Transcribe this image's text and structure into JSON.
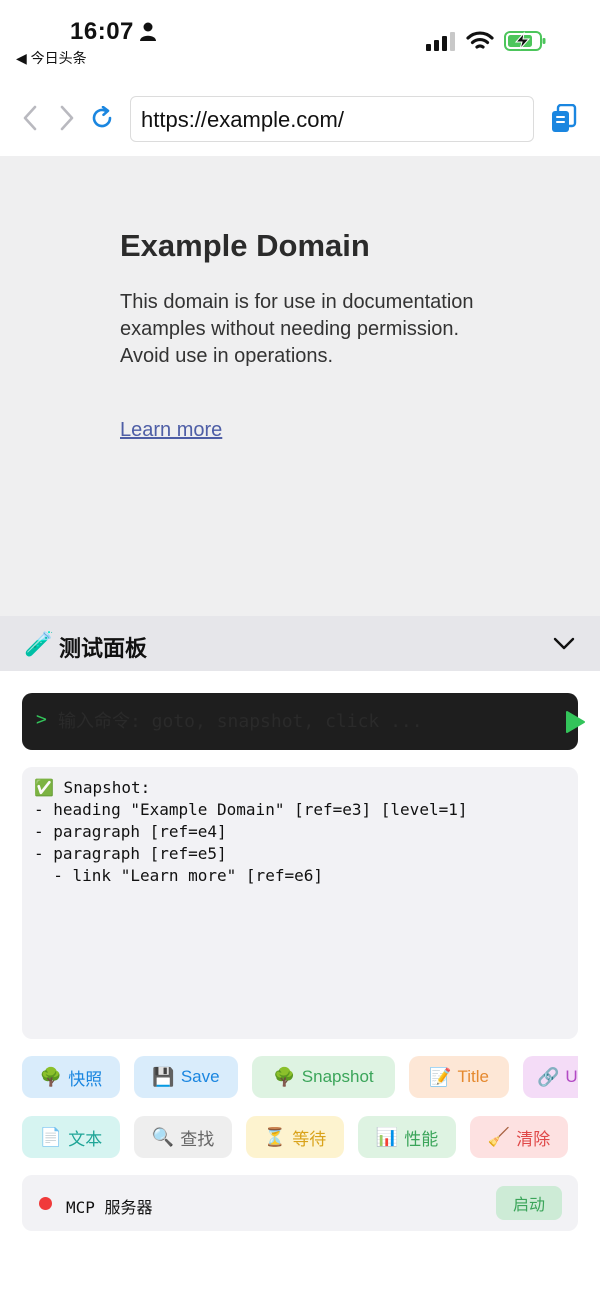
{
  "status_bar": {
    "time": "16:07",
    "back_app": "◀ 今日头条"
  },
  "browser": {
    "url": "https://example.com/"
  },
  "webpage": {
    "heading": "Example Domain",
    "paragraph": "This domain is for use in documentation examples without needing permission. Avoid use in operations.",
    "link": "Learn more"
  },
  "panel": {
    "emoji": "🧪",
    "title": "测试面板"
  },
  "command": {
    "prompt": ">",
    "placeholder": "输入命令: goto, snapshot, click ..."
  },
  "output": {
    "lines": [
      "✅ Snapshot:",
      "- heading \"Example Domain\" [ref=e3] [level=1]",
      "- paragraph [ref=e4]",
      "- paragraph [ref=e5]",
      "  - link \"Learn more\" [ref=e6]"
    ]
  },
  "actions_row1": [
    {
      "emoji": "🌳",
      "label": "快照"
    },
    {
      "emoji": "💾",
      "label": "Save"
    },
    {
      "emoji": "🌳",
      "label": "Snapshot"
    },
    {
      "emoji": "📝",
      "label": "Title"
    },
    {
      "emoji": "🔗",
      "label": "URL"
    }
  ],
  "actions_row2": [
    {
      "emoji": "📄",
      "label": "文本"
    },
    {
      "emoji": "🔍",
      "label": "查找"
    },
    {
      "emoji": "⏳",
      "label": "等待"
    },
    {
      "emoji": "📊",
      "label": "性能"
    },
    {
      "emoji": "🧹",
      "label": "清除"
    }
  ],
  "mcp": {
    "label": "MCP 服务器",
    "start_label": "启动"
  },
  "colors": {
    "accent_blue": "#1a86e0",
    "run_green": "#33c45a",
    "status_red": "#f03a3a"
  }
}
